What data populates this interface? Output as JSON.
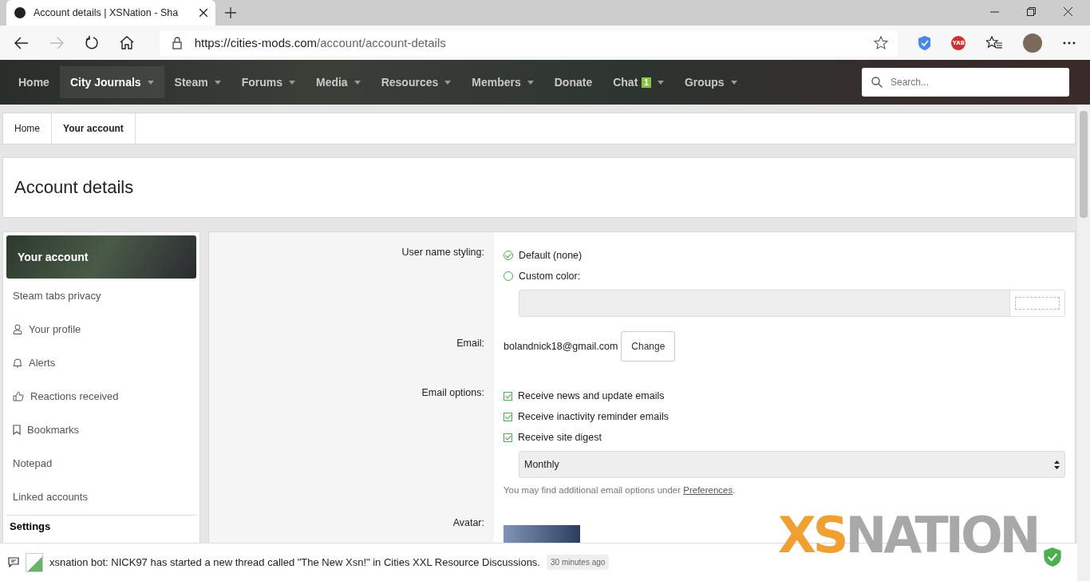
{
  "browser": {
    "tab_title": "Account details | XSNation - Sha",
    "url_host": "https://cities-mods.com",
    "url_path": "/account/account-details",
    "extension_badge": "YAB"
  },
  "nav": {
    "items": [
      {
        "label": "Home",
        "dropdown": false,
        "selected": false
      },
      {
        "label": "City Journals",
        "dropdown": true,
        "selected": true
      },
      {
        "label": "Steam",
        "dropdown": true,
        "selected": false
      },
      {
        "label": "Forums",
        "dropdown": true,
        "selected": false
      },
      {
        "label": "Media",
        "dropdown": true,
        "selected": false
      },
      {
        "label": "Resources",
        "dropdown": true,
        "selected": false
      },
      {
        "label": "Members",
        "dropdown": true,
        "selected": false
      },
      {
        "label": "Donate",
        "dropdown": false,
        "selected": false
      },
      {
        "label": "Chat",
        "dropdown": true,
        "selected": false,
        "badge": "1"
      },
      {
        "label": "Groups",
        "dropdown": true,
        "selected": false
      }
    ],
    "search_placeholder": "Search..."
  },
  "breadcrumb": [
    {
      "label": "Home",
      "current": false
    },
    {
      "label": "Your account",
      "current": true
    }
  ],
  "page_title": "Account details",
  "sidebar": {
    "header": "Your account",
    "items": [
      {
        "label": "Steam tabs privacy"
      },
      {
        "label": "Your profile"
      },
      {
        "label": "Alerts"
      },
      {
        "label": "Reactions received"
      },
      {
        "label": "Bookmarks"
      },
      {
        "label": "Notepad"
      },
      {
        "label": "Linked accounts"
      }
    ],
    "section": "Settings"
  },
  "form": {
    "styling_label": "User name styling:",
    "styling_options": [
      {
        "label": "Default (none)",
        "selected": true
      },
      {
        "label": "Custom color:",
        "selected": false
      }
    ],
    "email_label": "Email:",
    "email": "bolandnick18@gmail.com",
    "change_button": "Change",
    "options_label": "Email options:",
    "options": [
      {
        "label": "Receive news and update emails",
        "checked": true
      },
      {
        "label": "Receive inactivity reminder emails",
        "checked": true
      },
      {
        "label": "Receive site digest",
        "checked": true
      }
    ],
    "digest_value": "Monthly",
    "hint": {
      "before": "You may find additional email options under ",
      "link": "Preferences",
      "after": "."
    },
    "avatar_label": "Avatar:"
  },
  "notification": {
    "text": "xsnation bot: NICK97 has started a new thread called \"The New Xsn!\" in Cities XXL Resource Discussions.",
    "time": "30 minutes ago"
  },
  "logo": {
    "part_1": "XS",
    "part_2": "NATION"
  }
}
